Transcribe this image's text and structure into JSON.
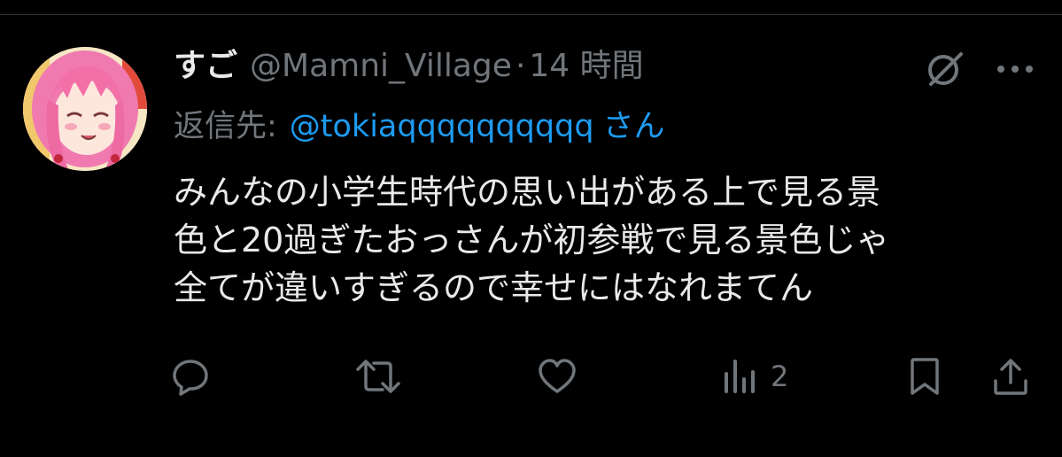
{
  "tweet": {
    "display_name": "すご",
    "handle": "@Mamni_Village",
    "separator": "·",
    "time": "14 時間",
    "reply_prefix": "返信先:",
    "reply_user": "@tokiaqqqqqqqqqq",
    "reply_suffix": "さん",
    "text_lines": [
      "みんなの小学生時代の思い出がある上で見る景",
      "色と20過ぎたおっさんが初参戦で見る景色じゃ",
      "全てが違いすぎるので幸せにはなれまてん"
    ]
  },
  "actions": {
    "reply": {
      "icon": "reply-icon"
    },
    "retweet": {
      "icon": "retweet-icon"
    },
    "like": {
      "icon": "like-icon"
    },
    "views": {
      "icon": "views-icon",
      "count": "2"
    },
    "bookmark": {
      "icon": "bookmark-icon"
    },
    "share": {
      "icon": "share-icon"
    }
  },
  "colors": {
    "background": "#000000",
    "text": "#e7e9ea",
    "secondary": "#71767b",
    "link": "#1d9bf0"
  }
}
